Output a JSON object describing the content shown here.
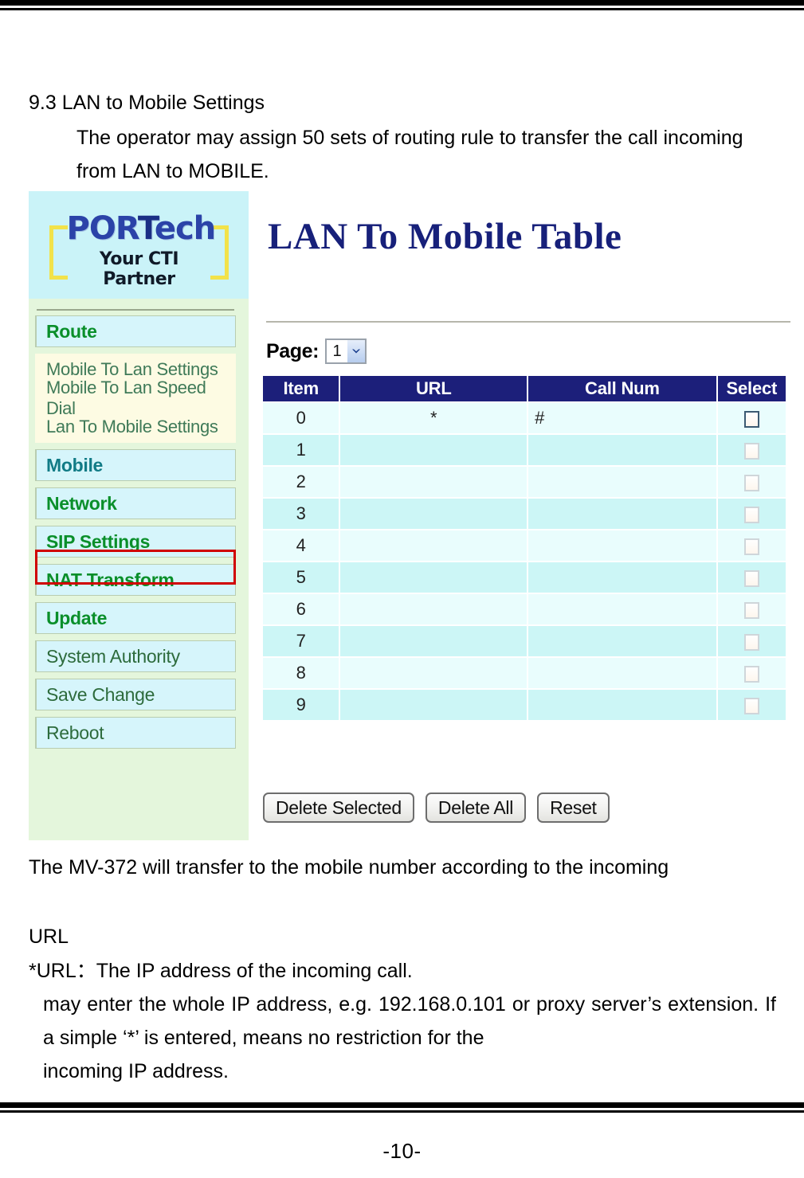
{
  "document": {
    "heading": "9.3 LAN to Mobile Settings",
    "intro": "The operator may assign 50 sets of  routing rule to transfer the call incoming from LAN to MOBILE.",
    "body1": "The MV-372 will transfer to the mobile number according to the incoming",
    "body2": "URL",
    "body3": "*URL：The IP address of the incoming call.",
    "body4": "may enter the whole IP address, e.g. 192.168.0.101 or proxy server’s extension. If a simple ‘*’ is entered, means no restriction for the",
    "body5": "incoming IP address.",
    "page_number": "-10-"
  },
  "webui": {
    "logo": {
      "word_part1": "POR",
      "word_part2": "T",
      "word_part3": "ech",
      "tagline": "Your CTI Partner"
    },
    "sidebar": {
      "items": [
        {
          "label": "Route",
          "style": "green"
        },
        {
          "label": "Mobile",
          "style": "teal"
        },
        {
          "label": "Network",
          "style": "green"
        },
        {
          "label": "SIP Settings",
          "style": "green"
        },
        {
          "label": "NAT Transform",
          "style": "green"
        },
        {
          "label": "Update",
          "style": "green"
        },
        {
          "label": "System Authority",
          "style": "plain"
        },
        {
          "label": "Save Change",
          "style": "plain"
        },
        {
          "label": "Reboot",
          "style": "plain"
        }
      ],
      "sub_items": [
        "Mobile To Lan Settings",
        "Mobile To Lan Speed Dial",
        "Lan To Mobile Settings"
      ],
      "highlighted_item": "Lan To Mobile Settings",
      "highlight_color": "#d00000"
    },
    "main": {
      "title": "LAN To Mobile Table",
      "page_label": "Page:",
      "page_value": "1",
      "table": {
        "headers": [
          "Item",
          "URL",
          "Call Num",
          "Select"
        ],
        "rows": [
          {
            "item": "0",
            "url": "*",
            "call_num": "#"
          },
          {
            "item": "1",
            "url": "",
            "call_num": ""
          },
          {
            "item": "2",
            "url": "",
            "call_num": ""
          },
          {
            "item": "3",
            "url": "",
            "call_num": ""
          },
          {
            "item": "4",
            "url": "",
            "call_num": ""
          },
          {
            "item": "5",
            "url": "",
            "call_num": ""
          },
          {
            "item": "6",
            "url": "",
            "call_num": ""
          },
          {
            "item": "7",
            "url": "",
            "call_num": ""
          },
          {
            "item": "8",
            "url": "",
            "call_num": ""
          },
          {
            "item": "9",
            "url": "",
            "call_num": ""
          }
        ]
      },
      "buttons": [
        "Delete Selected",
        "Delete All",
        "Reset"
      ]
    },
    "colors": {
      "header_bg": "#1c1f7a",
      "title": "#17207a",
      "logo_blue": "#2b43a8",
      "logo_bracket": "#f2e24a",
      "nav_bg": "#d6f5fb",
      "sidebar_bg": "#e4f6dc",
      "logo_bg": "#caf3f8"
    }
  }
}
